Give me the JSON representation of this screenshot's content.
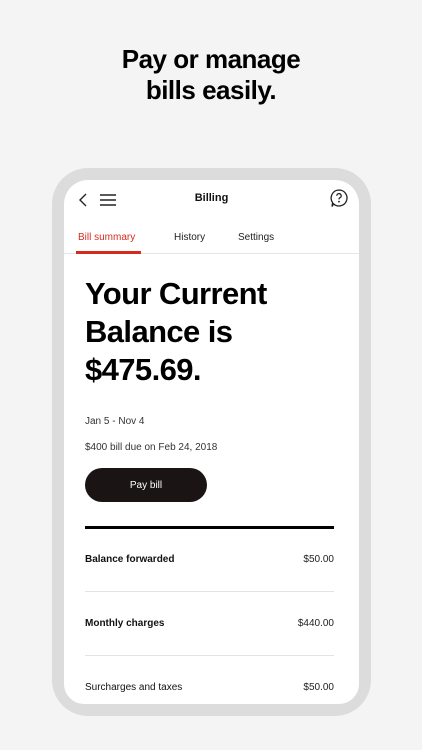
{
  "promo": {
    "line1": "Pay or manage",
    "line2": "bills easily."
  },
  "app_bar": {
    "title": "Billing",
    "icons": [
      "chevron-left-icon",
      "hamburger-menu-icon",
      "help-chat-icon"
    ]
  },
  "tabs": [
    {
      "label": "Bill summary",
      "active": true
    },
    {
      "label": "History",
      "active": false
    },
    {
      "label": "Settings",
      "active": false
    }
  ],
  "balance": {
    "line1": "Your Current",
    "line2": "Balance is",
    "amount": "$475.69."
  },
  "period": "Jan 5 - Nov 4",
  "due_note": "$400 bill due on Feb 24, 2018",
  "pay_button_label": "Pay bill",
  "line_items": [
    {
      "label": "Balance forwarded",
      "amount": "$50.00"
    },
    {
      "label": "Monthly charges",
      "amount": "$440.00"
    },
    {
      "label": "Surcharges and taxes",
      "amount": "$50.00"
    }
  ],
  "colors": {
    "accent": "#d52b1e",
    "button_bg": "#1a1414",
    "background": "#f4f4f4"
  }
}
